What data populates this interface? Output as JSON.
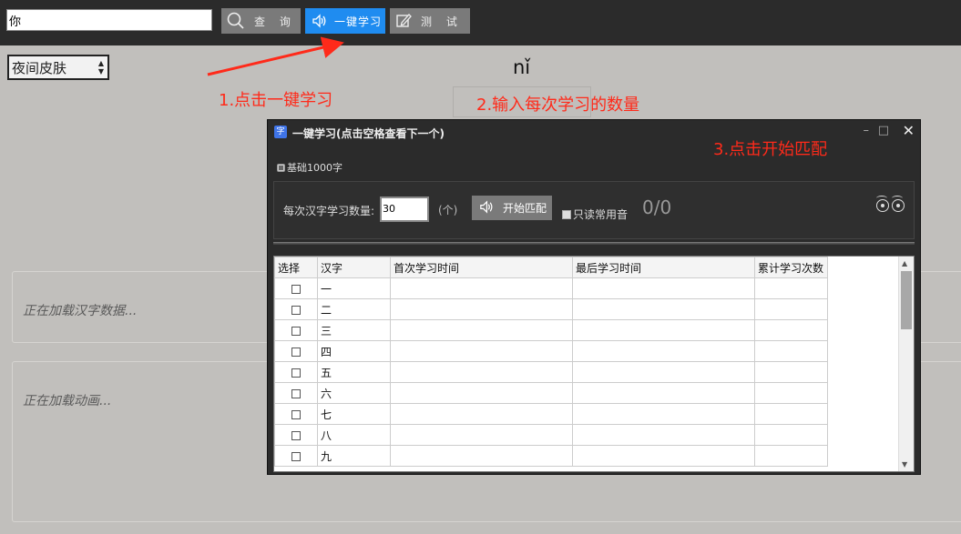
{
  "toolbar": {
    "search_value": "你",
    "query_label": "查 询",
    "learn_label": "一键学习",
    "test_label": "测 试"
  },
  "skin": {
    "selected": "夜间皮肤"
  },
  "pinyin": "nǐ",
  "annotations": {
    "step1": "1.点击一键学习",
    "step2": "2.输入每次学习的数量",
    "step3": "3.点击开始匹配"
  },
  "panels": {
    "loading_chars": "正在加载汉字数据...",
    "loading_anim": "正在加载动画..."
  },
  "dialog": {
    "icon_char": "字",
    "title": "一键学习(点击空格查看下一个)",
    "radio_label": "基础1000字",
    "count_label": "每次汉字学习数量:",
    "count_value": "30",
    "unit": "(个)",
    "match_label": "开始匹配",
    "common_label": "只读常用音",
    "progress": "0/0",
    "columns": [
      "选择",
      "汉字",
      "首次学习时间",
      "最后学习时间",
      "累计学习次数"
    ],
    "rows": [
      {
        "char": "一"
      },
      {
        "char": "二"
      },
      {
        "char": "三"
      },
      {
        "char": "四"
      },
      {
        "char": "五"
      },
      {
        "char": "六"
      },
      {
        "char": "七"
      },
      {
        "char": "八"
      },
      {
        "char": "九"
      }
    ]
  },
  "colors": {
    "accent": "#1f8cf0",
    "annotation": "#ff2a1a",
    "topbar": "#2b2b2b",
    "background": "#c1bfbc"
  }
}
